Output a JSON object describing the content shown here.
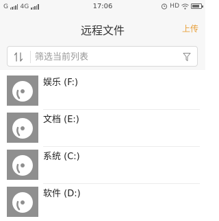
{
  "status_bar": {
    "carrier": "G",
    "network": "4G",
    "time": "17:06",
    "right_label": "HD",
    "icons": [
      "signal-icon",
      "alarm-icon",
      "wifi-icon",
      "battery-icon"
    ]
  },
  "header": {
    "title": "远程文件",
    "action_label": "上传",
    "accent_color": "#e8a03a"
  },
  "filter": {
    "placeholder": "筛选当前列表",
    "icons": [
      "sort-icon",
      "filter-icon"
    ]
  },
  "drives": [
    {
      "label": "娱乐 (F:)",
      "icon": "disk-icon"
    },
    {
      "label": "文档 (E:)",
      "icon": "disk-icon"
    },
    {
      "label": "系统 (C:)",
      "icon": "disk-icon"
    },
    {
      "label": "软件 (D:)",
      "icon": "disk-icon"
    }
  ]
}
